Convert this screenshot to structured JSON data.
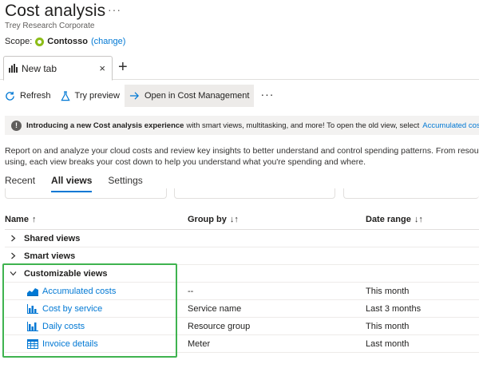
{
  "header": {
    "title": "Cost analysis",
    "more": "···",
    "subtitle": "Trey Research Corporate",
    "scope_label": "Scope:",
    "scope_name": "Contosso",
    "scope_change": "(change)"
  },
  "tabs": {
    "active_tab": "New tab",
    "close": "×",
    "add": "+"
  },
  "toolbar": {
    "refresh": "Refresh",
    "try_preview": "Try preview",
    "open_cost_mgmt": "Open in Cost Management",
    "more": "···"
  },
  "info": {
    "icon": "!",
    "bold": "Introducing a new Cost analysis experience",
    "text": "with smart views, multitasking, and more! To open the old view, select",
    "link": "Accumulated costs."
  },
  "description": {
    "line1": "Report on and analyze your cloud costs and review key insights to better understand and control spending patterns. From resources",
    "line2": "using, each view breaks your cost down to help you understand what you're spending and where."
  },
  "view_tabs": [
    "Recent",
    "All views",
    "Settings"
  ],
  "table": {
    "headers": {
      "name": "Name",
      "name_sort": "↑",
      "group_by": "Group by",
      "group_sort": "↓↑",
      "date_range": "Date range",
      "date_sort": "↓↑"
    },
    "groups": [
      {
        "label": "Shared views",
        "chevron": "›"
      },
      {
        "label": "Smart views",
        "chevron": "›"
      },
      {
        "label": "Customizable views",
        "chevron": "⌄"
      }
    ],
    "items": [
      {
        "name": "Accumulated costs",
        "group_by": "--",
        "date_range": "This month",
        "icon": "area-chart-icon"
      },
      {
        "name": "Cost by service",
        "group_by": "Service name",
        "date_range": "Last 3 months",
        "icon": "bar-chart-icon"
      },
      {
        "name": "Daily costs",
        "group_by": "Resource group",
        "date_range": "This month",
        "icon": "bar-chart-icon"
      },
      {
        "name": "Invoice details",
        "group_by": "Meter",
        "date_range": "Last month",
        "icon": "table-icon"
      }
    ]
  },
  "colors": {
    "link": "#0078d4",
    "highlight": "#3fb34f",
    "scope_icon": "#8cbd18"
  }
}
